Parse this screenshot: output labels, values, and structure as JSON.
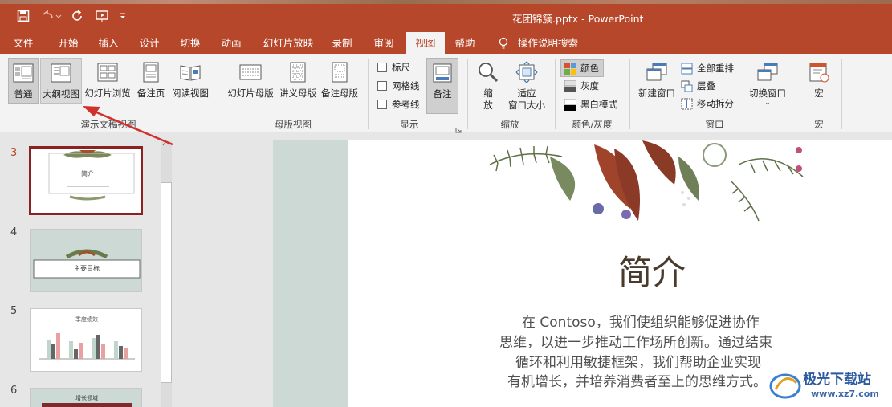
{
  "titlebar": {
    "document_title": "花团锦簇.pptx  -  PowerPoint"
  },
  "tabs": [
    {
      "label": "文件",
      "active": false
    },
    {
      "label": "开始",
      "active": false
    },
    {
      "label": "插入",
      "active": false
    },
    {
      "label": "设计",
      "active": false
    },
    {
      "label": "切换",
      "active": false
    },
    {
      "label": "动画",
      "active": false
    },
    {
      "label": "幻灯片放映",
      "active": false
    },
    {
      "label": "录制",
      "active": false
    },
    {
      "label": "审阅",
      "active": false
    },
    {
      "label": "视图",
      "active": true
    },
    {
      "label": "帮助",
      "active": false
    }
  ],
  "tell_me": "操作说明搜索",
  "ribbon": {
    "presentation_views": {
      "normal": "普通",
      "outline": "大纲视图",
      "slide_sorter": "幻灯片浏览",
      "notes_page": "备注页",
      "reading_view": "阅读视图",
      "group_label": "演示文稿视图"
    },
    "master_views": {
      "slide_master": "幻灯片母版",
      "handout_master": "讲义母版",
      "notes_master": "备注母版",
      "group_label": "母版视图"
    },
    "show": {
      "ruler": "标尺",
      "gridlines": "网格线",
      "guides": "参考线",
      "notes": "备注",
      "group_label": "显示"
    },
    "zoom": {
      "zoom_line1": "缩",
      "zoom_line2": "放",
      "fit_line1": "适应",
      "fit_line2": "窗口大小",
      "group_label": "缩放"
    },
    "color": {
      "color": "颜色",
      "grayscale": "灰度",
      "black_white": "黑白模式",
      "group_label": "颜色/灰度"
    },
    "window": {
      "new_window": "新建窗口",
      "arrange_all": "全部重排",
      "cascade": "层叠",
      "move_split": "移动拆分",
      "switch_windows": "切换窗口",
      "group_label": "窗口"
    },
    "macros": {
      "macros": "宏",
      "group_label": "宏"
    }
  },
  "thumbnails": {
    "numbers": [
      "3",
      "4",
      "5",
      "6"
    ],
    "slide3_title": "简介",
    "slide4_title": "主要目标",
    "slide5_title": "季度绩效",
    "slide6_title": "增长领域"
  },
  "slide": {
    "title": "简介",
    "body_lines": [
      "在 Contoso，我们使组织能够促进协作",
      "思维，以进一步推动工作场所创新。通过结束",
      "循环和利用敏捷框架，我们帮助企业实现",
      "有机增长，并培养消费者至上的思维方式。"
    ]
  },
  "watermark": {
    "name": "极光下载站",
    "url": "www.xz7.com"
  },
  "colors": {
    "accent": "#b7472a",
    "annotation_arrow": "#d0312d"
  }
}
